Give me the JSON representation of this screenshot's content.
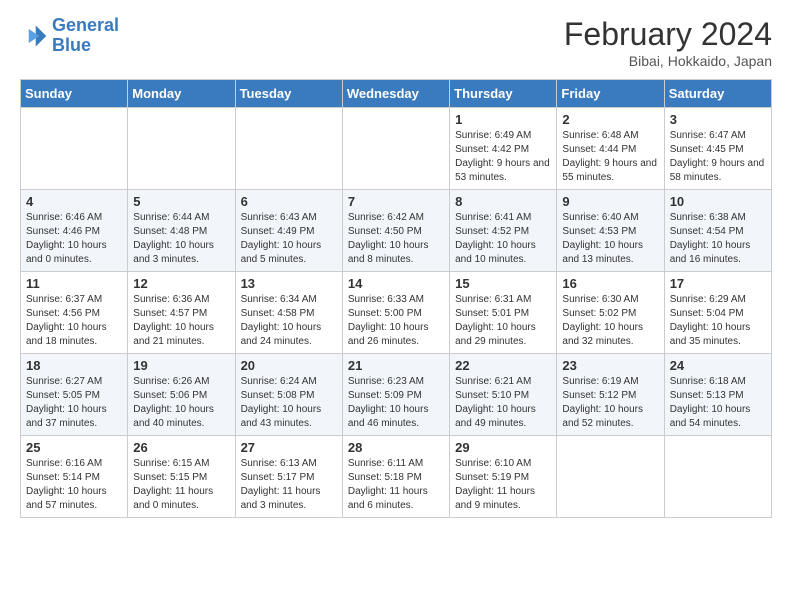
{
  "logo": {
    "line1": "General",
    "line2": "Blue"
  },
  "title": "February 2024",
  "subtitle": "Bibai, Hokkaido, Japan",
  "days_of_week": [
    "Sunday",
    "Monday",
    "Tuesday",
    "Wednesday",
    "Thursday",
    "Friday",
    "Saturday"
  ],
  "weeks": [
    [
      {
        "day": "",
        "info": ""
      },
      {
        "day": "",
        "info": ""
      },
      {
        "day": "",
        "info": ""
      },
      {
        "day": "",
        "info": ""
      },
      {
        "day": "1",
        "info": "Sunrise: 6:49 AM\nSunset: 4:42 PM\nDaylight: 9 hours and 53 minutes."
      },
      {
        "day": "2",
        "info": "Sunrise: 6:48 AM\nSunset: 4:44 PM\nDaylight: 9 hours and 55 minutes."
      },
      {
        "day": "3",
        "info": "Sunrise: 6:47 AM\nSunset: 4:45 PM\nDaylight: 9 hours and 58 minutes."
      }
    ],
    [
      {
        "day": "4",
        "info": "Sunrise: 6:46 AM\nSunset: 4:46 PM\nDaylight: 10 hours and 0 minutes."
      },
      {
        "day": "5",
        "info": "Sunrise: 6:44 AM\nSunset: 4:48 PM\nDaylight: 10 hours and 3 minutes."
      },
      {
        "day": "6",
        "info": "Sunrise: 6:43 AM\nSunset: 4:49 PM\nDaylight: 10 hours and 5 minutes."
      },
      {
        "day": "7",
        "info": "Sunrise: 6:42 AM\nSunset: 4:50 PM\nDaylight: 10 hours and 8 minutes."
      },
      {
        "day": "8",
        "info": "Sunrise: 6:41 AM\nSunset: 4:52 PM\nDaylight: 10 hours and 10 minutes."
      },
      {
        "day": "9",
        "info": "Sunrise: 6:40 AM\nSunset: 4:53 PM\nDaylight: 10 hours and 13 minutes."
      },
      {
        "day": "10",
        "info": "Sunrise: 6:38 AM\nSunset: 4:54 PM\nDaylight: 10 hours and 16 minutes."
      }
    ],
    [
      {
        "day": "11",
        "info": "Sunrise: 6:37 AM\nSunset: 4:56 PM\nDaylight: 10 hours and 18 minutes."
      },
      {
        "day": "12",
        "info": "Sunrise: 6:36 AM\nSunset: 4:57 PM\nDaylight: 10 hours and 21 minutes."
      },
      {
        "day": "13",
        "info": "Sunrise: 6:34 AM\nSunset: 4:58 PM\nDaylight: 10 hours and 24 minutes."
      },
      {
        "day": "14",
        "info": "Sunrise: 6:33 AM\nSunset: 5:00 PM\nDaylight: 10 hours and 26 minutes."
      },
      {
        "day": "15",
        "info": "Sunrise: 6:31 AM\nSunset: 5:01 PM\nDaylight: 10 hours and 29 minutes."
      },
      {
        "day": "16",
        "info": "Sunrise: 6:30 AM\nSunset: 5:02 PM\nDaylight: 10 hours and 32 minutes."
      },
      {
        "day": "17",
        "info": "Sunrise: 6:29 AM\nSunset: 5:04 PM\nDaylight: 10 hours and 35 minutes."
      }
    ],
    [
      {
        "day": "18",
        "info": "Sunrise: 6:27 AM\nSunset: 5:05 PM\nDaylight: 10 hours and 37 minutes."
      },
      {
        "day": "19",
        "info": "Sunrise: 6:26 AM\nSunset: 5:06 PM\nDaylight: 10 hours and 40 minutes."
      },
      {
        "day": "20",
        "info": "Sunrise: 6:24 AM\nSunset: 5:08 PM\nDaylight: 10 hours and 43 minutes."
      },
      {
        "day": "21",
        "info": "Sunrise: 6:23 AM\nSunset: 5:09 PM\nDaylight: 10 hours and 46 minutes."
      },
      {
        "day": "22",
        "info": "Sunrise: 6:21 AM\nSunset: 5:10 PM\nDaylight: 10 hours and 49 minutes."
      },
      {
        "day": "23",
        "info": "Sunrise: 6:19 AM\nSunset: 5:12 PM\nDaylight: 10 hours and 52 minutes."
      },
      {
        "day": "24",
        "info": "Sunrise: 6:18 AM\nSunset: 5:13 PM\nDaylight: 10 hours and 54 minutes."
      }
    ],
    [
      {
        "day": "25",
        "info": "Sunrise: 6:16 AM\nSunset: 5:14 PM\nDaylight: 10 hours and 57 minutes."
      },
      {
        "day": "26",
        "info": "Sunrise: 6:15 AM\nSunset: 5:15 PM\nDaylight: 11 hours and 0 minutes."
      },
      {
        "day": "27",
        "info": "Sunrise: 6:13 AM\nSunset: 5:17 PM\nDaylight: 11 hours and 3 minutes."
      },
      {
        "day": "28",
        "info": "Sunrise: 6:11 AM\nSunset: 5:18 PM\nDaylight: 11 hours and 6 minutes."
      },
      {
        "day": "29",
        "info": "Sunrise: 6:10 AM\nSunset: 5:19 PM\nDaylight: 11 hours and 9 minutes."
      },
      {
        "day": "",
        "info": ""
      },
      {
        "day": "",
        "info": ""
      }
    ]
  ]
}
